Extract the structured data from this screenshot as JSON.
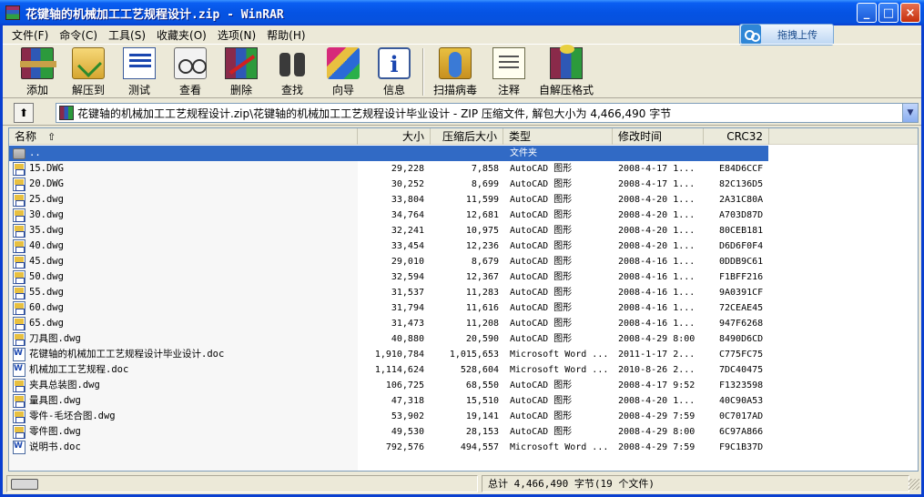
{
  "window": {
    "title": "花键轴的机械加工工艺规程设计.zip - WinRAR",
    "min": "_",
    "max": "□",
    "close": "×"
  },
  "menu": [
    "文件(F)",
    "命令(C)",
    "工具(S)",
    "收藏夹(O)",
    "选项(N)",
    "帮助(H)"
  ],
  "upload": {
    "label": "拖拽上传"
  },
  "toolbar": {
    "add": "添加",
    "extract": "解压到",
    "test": "测试",
    "view": "查看",
    "delete": "删除",
    "find": "查找",
    "wizard": "向导",
    "info": "信息",
    "scan": "扫描病毒",
    "comment": "注释",
    "sfx": "自解压格式"
  },
  "address": {
    "up": "⬆",
    "path": "花键轴的机械加工工艺规程设计.zip\\花键轴的机械加工工艺规程设计毕业设计 - ZIP 压缩文件, 解包大小为 4,466,490 字节",
    "drop": "▼"
  },
  "columns": {
    "name": "名称",
    "sort": "⇧",
    "size": "大小",
    "packed": "压缩后大小",
    "type": "类型",
    "modified": "修改时间",
    "crc": "CRC32"
  },
  "parent_row": {
    "name": "..",
    "type": "文件夹"
  },
  "files": [
    {
      "name": "15.DWG",
      "size": "29,228",
      "packed": "7,858",
      "type": "AutoCAD 图形",
      "modified": "2008-4-17 1...",
      "crc": "E84D6CCF",
      "icon": "dwg"
    },
    {
      "name": "20.DWG",
      "size": "30,252",
      "packed": "8,699",
      "type": "AutoCAD 图形",
      "modified": "2008-4-17 1...",
      "crc": "82C136D5",
      "icon": "dwg"
    },
    {
      "name": "25.dwg",
      "size": "33,804",
      "packed": "11,599",
      "type": "AutoCAD 图形",
      "modified": "2008-4-20 1...",
      "crc": "2A31C80A",
      "icon": "dwg"
    },
    {
      "name": "30.dwg",
      "size": "34,764",
      "packed": "12,681",
      "type": "AutoCAD 图形",
      "modified": "2008-4-20 1...",
      "crc": "A703D87D",
      "icon": "dwg"
    },
    {
      "name": "35.dwg",
      "size": "32,241",
      "packed": "10,975",
      "type": "AutoCAD 图形",
      "modified": "2008-4-20 1...",
      "crc": "80CEB181",
      "icon": "dwg"
    },
    {
      "name": "40.dwg",
      "size": "33,454",
      "packed": "12,236",
      "type": "AutoCAD 图形",
      "modified": "2008-4-20 1...",
      "crc": "D6D6F0F4",
      "icon": "dwg"
    },
    {
      "name": "45.dwg",
      "size": "29,010",
      "packed": "8,679",
      "type": "AutoCAD 图形",
      "modified": "2008-4-16 1...",
      "crc": "0DDB9C61",
      "icon": "dwg"
    },
    {
      "name": "50.dwg",
      "size": "32,594",
      "packed": "12,367",
      "type": "AutoCAD 图形",
      "modified": "2008-4-16 1...",
      "crc": "F1BFF216",
      "icon": "dwg"
    },
    {
      "name": "55.dwg",
      "size": "31,537",
      "packed": "11,283",
      "type": "AutoCAD 图形",
      "modified": "2008-4-16 1...",
      "crc": "9A0391CF",
      "icon": "dwg"
    },
    {
      "name": "60.dwg",
      "size": "31,794",
      "packed": "11,616",
      "type": "AutoCAD 图形",
      "modified": "2008-4-16 1...",
      "crc": "72CEAE45",
      "icon": "dwg"
    },
    {
      "name": "65.dwg",
      "size": "31,473",
      "packed": "11,208",
      "type": "AutoCAD 图形",
      "modified": "2008-4-16 1...",
      "crc": "947F6268",
      "icon": "dwg"
    },
    {
      "name": "刀具图.dwg",
      "size": "40,880",
      "packed": "20,590",
      "type": "AutoCAD 图形",
      "modified": "2008-4-29 8:00",
      "crc": "8490D6CD",
      "icon": "dwg"
    },
    {
      "name": "花键轴的机械加工工艺规程设计毕业设计.doc",
      "size": "1,910,784",
      "packed": "1,015,653",
      "type": "Microsoft Word ...",
      "modified": "2011-1-17 2...",
      "crc": "C775FC75",
      "icon": "doc"
    },
    {
      "name": "机械加工工艺规程.doc",
      "size": "1,114,624",
      "packed": "528,604",
      "type": "Microsoft Word ...",
      "modified": "2010-8-26 2...",
      "crc": "7DC40475",
      "icon": "doc"
    },
    {
      "name": "夹具总装图.dwg",
      "size": "106,725",
      "packed": "68,550",
      "type": "AutoCAD 图形",
      "modified": "2008-4-17 9:52",
      "crc": "F1323598",
      "icon": "dwg"
    },
    {
      "name": "量具图.dwg",
      "size": "47,318",
      "packed": "15,510",
      "type": "AutoCAD 图形",
      "modified": "2008-4-20 1...",
      "crc": "40C90A53",
      "icon": "dwg"
    },
    {
      "name": "零件-毛坯合图.dwg",
      "size": "53,902",
      "packed": "19,141",
      "type": "AutoCAD 图形",
      "modified": "2008-4-29 7:59",
      "crc": "0C7017AD",
      "icon": "dwg"
    },
    {
      "name": "零件图.dwg",
      "size": "49,530",
      "packed": "28,153",
      "type": "AutoCAD 图形",
      "modified": "2008-4-29 8:00",
      "crc": "6C97A866",
      "icon": "dwg"
    },
    {
      "name": "说明书.doc",
      "size": "792,576",
      "packed": "494,557",
      "type": "Microsoft Word ...",
      "modified": "2008-4-29 7:59",
      "crc": "F9C1B37D",
      "icon": "doc"
    }
  ],
  "status": {
    "total": "总计 4,466,490 字节(19 个文件)"
  }
}
